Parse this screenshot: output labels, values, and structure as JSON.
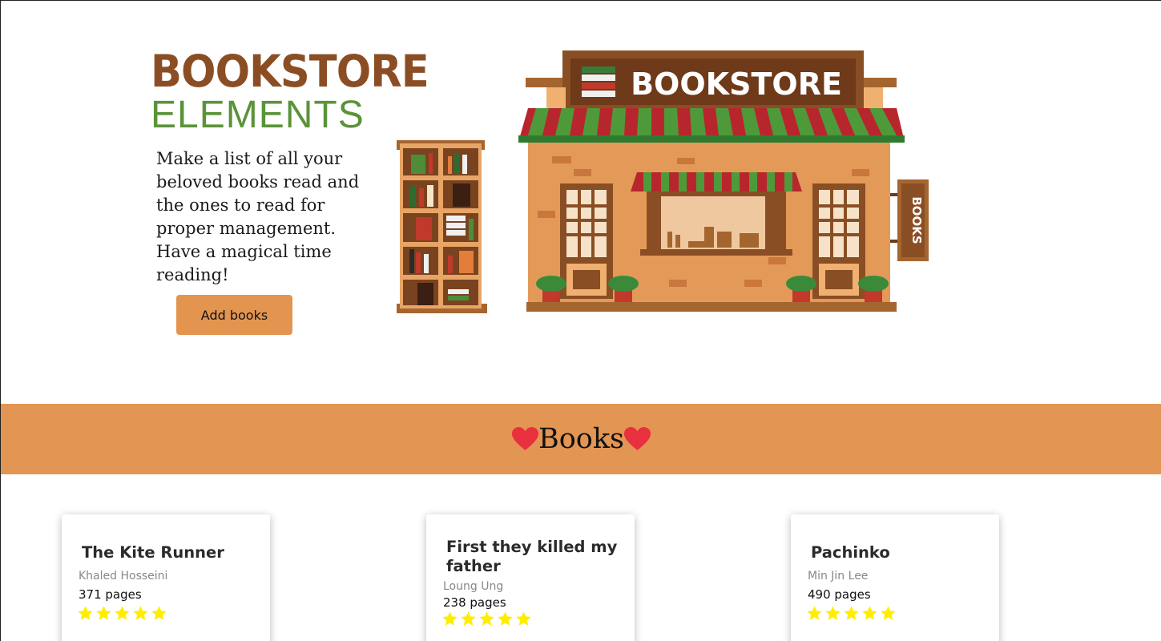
{
  "hero": {
    "logo_top": "BOOKSTORE",
    "logo_bottom": "ELEMENTS",
    "tagline": "Make a list of all your beloved books read and the ones to read for proper management. Have a magical time reading!",
    "add_button": "Add books",
    "illustration": {
      "sign_text": "BOOKSTORE",
      "side_sign_text": "BOOKS"
    }
  },
  "books_section": {
    "heading": "Books",
    "heading_icon": "heart-icon",
    "heart_color": "#e8303f"
  },
  "colors": {
    "accent": "#e39553",
    "logo_brown": "#8b4e24",
    "logo_green": "#5a9338",
    "star": "#ffee00"
  },
  "books": [
    {
      "title": "The Kite Runner",
      "author": "Khaled Hosseini",
      "pages": "371 pages",
      "rating": 5
    },
    {
      "title": "First they killed my father",
      "author": "Loung Ung",
      "pages": "238 pages",
      "rating": 5
    },
    {
      "title": "Pachinko",
      "author": "Min Jin Lee",
      "pages": "490 pages",
      "rating": 5
    }
  ]
}
